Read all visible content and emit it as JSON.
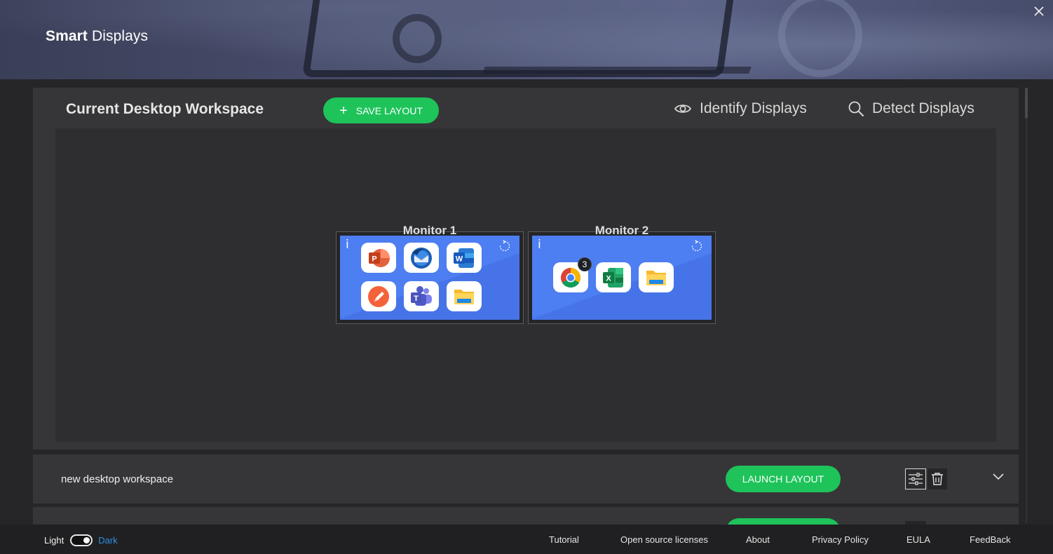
{
  "app": {
    "title_bold": "Smart",
    "title_rest": " Displays",
    "close_label": "✕"
  },
  "workspace": {
    "title": "Current Desktop Workspace",
    "save_label": "SAVE LAYOUT",
    "identify_label": "Identify Displays",
    "detect_label": "Detect Displays",
    "info_glyph": "i",
    "monitors": [
      {
        "label": "Monitor 1",
        "apps": [
          "powerpoint-icon",
          "thunderbird-icon",
          "word-icon",
          "draw-app-icon",
          "teams-icon",
          "file-explorer-icon"
        ]
      },
      {
        "label": "Monitor 2",
        "apps": [
          "chrome-icon",
          "excel-icon",
          "file-explorer-icon"
        ],
        "chrome_badge": "3"
      }
    ]
  },
  "layouts": [
    {
      "name": "new desktop workspace",
      "launch_label": "LAUNCH LAYOUT"
    }
  ],
  "footer": {
    "light_label": "Light",
    "dark_label": "Dark",
    "links": [
      "Tutorial",
      "Open source licenses",
      "About",
      "Privacy Policy",
      "EULA",
      "FeedBack"
    ]
  },
  "colors": {
    "accent_green": "#1ec35a",
    "screen_blue": "#4d7ef2",
    "dark_link": "#2f8fe8"
  }
}
